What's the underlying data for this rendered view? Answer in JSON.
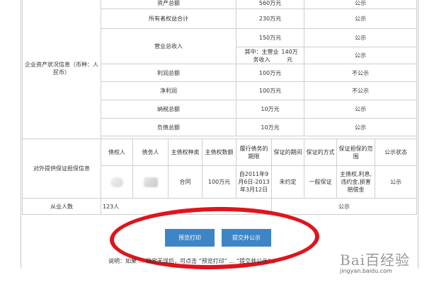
{
  "assets": {
    "section_label": "企业资产状况信息（币种：人民币）",
    "rows": [
      {
        "label": "资产总额",
        "value": "560万元",
        "status": "公示"
      },
      {
        "label": "所有者权益合计",
        "value": "230万元",
        "status": "公示"
      },
      {
        "label": "营业总收入",
        "value": "150万元",
        "status": "公示"
      },
      {
        "label": "其中：主营业务收入",
        "value": "140万元",
        "status": "公示"
      },
      {
        "label": "利润总额",
        "value": "100万元",
        "status": "不公示"
      },
      {
        "label": "净利润",
        "value": "100万元",
        "status": "不公示"
      },
      {
        "label": "纳税总额",
        "value": "10万元",
        "status": "公示"
      },
      {
        "label": "负债总额",
        "value": "10万元",
        "status": "公示"
      }
    ]
  },
  "guarantee": {
    "section_label": "对外提供保证担保信息",
    "headers": [
      "债权人",
      "债务人",
      "主债权种类",
      "主债权数额",
      "履行债务的期限",
      "保证的期间",
      "保证的方式",
      "保证担保的范围",
      "公示状态"
    ],
    "row": {
      "type": "合同",
      "amount": "100万元",
      "period": "自2011年9月6日-2013年3月12日",
      "guarantee_period": "未约定",
      "method": "一般保证",
      "scope": "主债权,利息,违约金,损害赔偿金",
      "status": "公示"
    }
  },
  "employees": {
    "label": "从业人数",
    "value": "123人",
    "status": "公示"
  },
  "buttons": {
    "preview_print": "预览打印",
    "submit_publish": "提交并公示"
  },
  "note": "说明：如果  …  确定无误后，可点击  “预览打印”  …  “提交并公示”  。",
  "watermark": {
    "brand": "Bai百经验",
    "url": "jingyan.baidu.com"
  },
  "colors": {
    "button": "#3d85c6",
    "ellipse": "#e0141c"
  }
}
